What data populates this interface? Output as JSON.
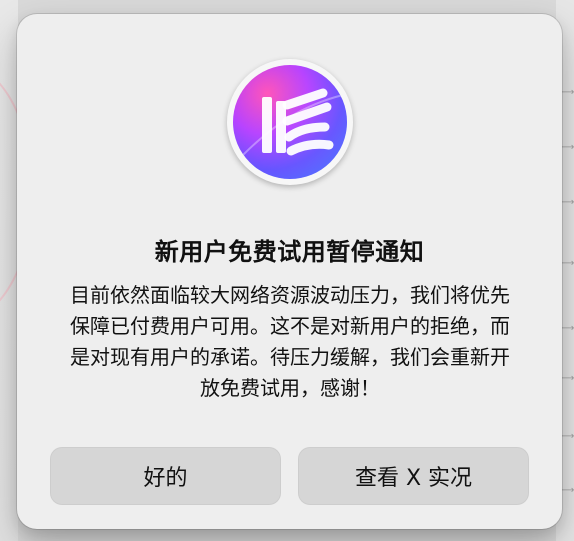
{
  "dialog": {
    "title": "新用户免费试用暂停通知",
    "message": "目前依然面临较大网络资源波动压力，我们将优先保障已付费用户可用。这不是对新用户的拒绝，而是对现有用户的承诺。待压力缓解，我们会重新开放免费试用，感谢！",
    "buttons": {
      "ok_label": "好的",
      "view_x_label": "查看 X 实况"
    },
    "icon": {
      "semantic": "app-logo-icon",
      "brand_colors": [
        "#ff4fb8",
        "#b53cff",
        "#5a47ff",
        "#2f6bff"
      ]
    }
  },
  "colors": {
    "backdrop": "#d9d9d9",
    "dialog_bg": "#eeeeee",
    "button_bg": "#d6d6d6",
    "text": "#111111"
  }
}
